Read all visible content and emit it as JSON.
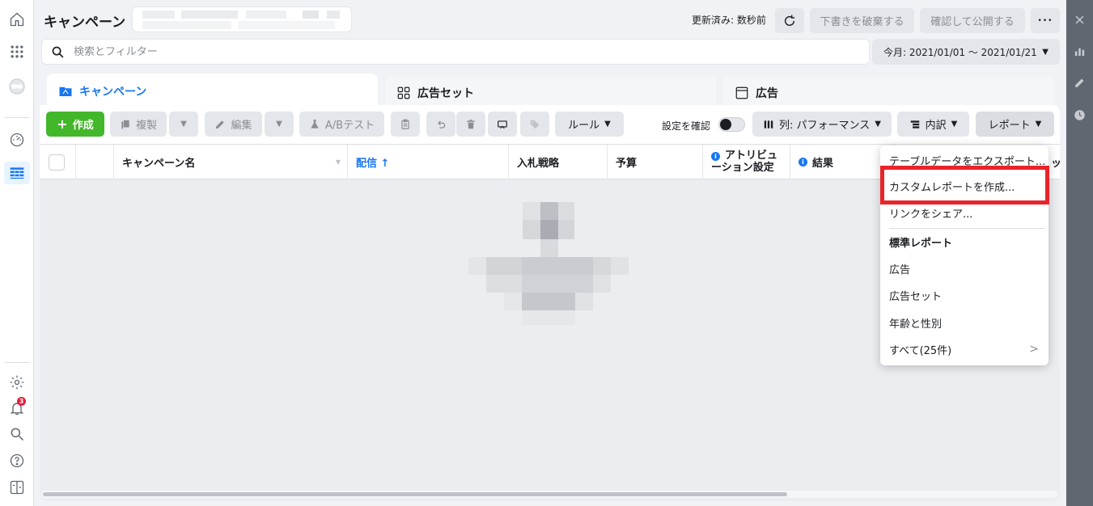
{
  "header": {
    "title": "キャンペーン",
    "updated": "更新済み: 数秒前",
    "discard_label": "下書きを破棄する",
    "publish_label": "確認して公開する",
    "more_label": "•••"
  },
  "search": {
    "placeholder": "検索とフィルター"
  },
  "date_range": "今月: 2021/01/01 ～ 2021/01/21",
  "tabs": [
    {
      "label": "キャンペーン"
    },
    {
      "label": "広告セット"
    },
    {
      "label": "広告"
    }
  ],
  "toolbar": {
    "create": "作成",
    "duplicate": "複製",
    "edit": "編集",
    "ab_test": "A/Bテスト",
    "rules": "ルール",
    "review_toggle": "設定を確認",
    "columns": "列: パフォーマンス",
    "breakdown": "内訳",
    "reports": "レポート"
  },
  "table": {
    "headers": {
      "name": "キャンペーン名",
      "delivery": "配信 ↑",
      "bid": "入札戦略",
      "budget": "予算",
      "attribution_line1": "アトリビュ",
      "attribution_line2": "ーション設定",
      "results": "結果",
      "extra": "ッ"
    }
  },
  "report_menu": {
    "items": [
      {
        "label": "テーブルデータをエクスポート..."
      },
      {
        "label": "カスタムレポートを作成..."
      },
      {
        "label": "リンクをシェア..."
      },
      {
        "label": "標準レポート"
      },
      {
        "label": "広告"
      },
      {
        "label": "広告セット"
      },
      {
        "label": "年齢と性別"
      },
      {
        "label": "すべて(25件)"
      }
    ]
  },
  "notifications": {
    "count": "3"
  },
  "colors": {
    "accent": "#1877f2",
    "create": "#42b72a",
    "highlight": "#e8242a"
  }
}
